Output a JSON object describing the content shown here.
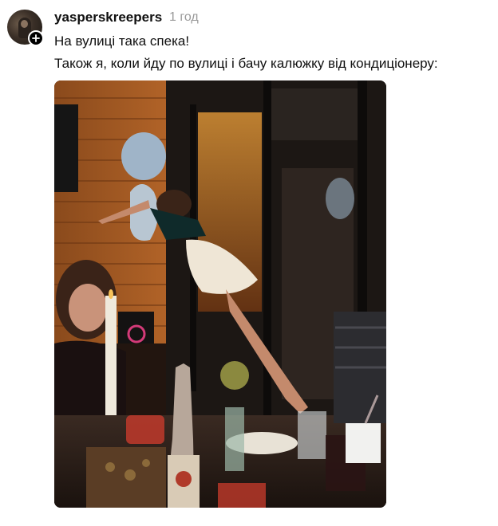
{
  "post": {
    "author": {
      "username": "yasperskreepers",
      "avatar_icon": "user-avatar",
      "follow_icon": "plus-icon"
    },
    "timestamp": "1 год",
    "text_lines": [
      "На вулиці така спека!",
      "Також я, коли йду по вулиці і бачу калюжку від кондиціонеру:"
    ],
    "photo_description": "party photo with woman and balloons"
  }
}
